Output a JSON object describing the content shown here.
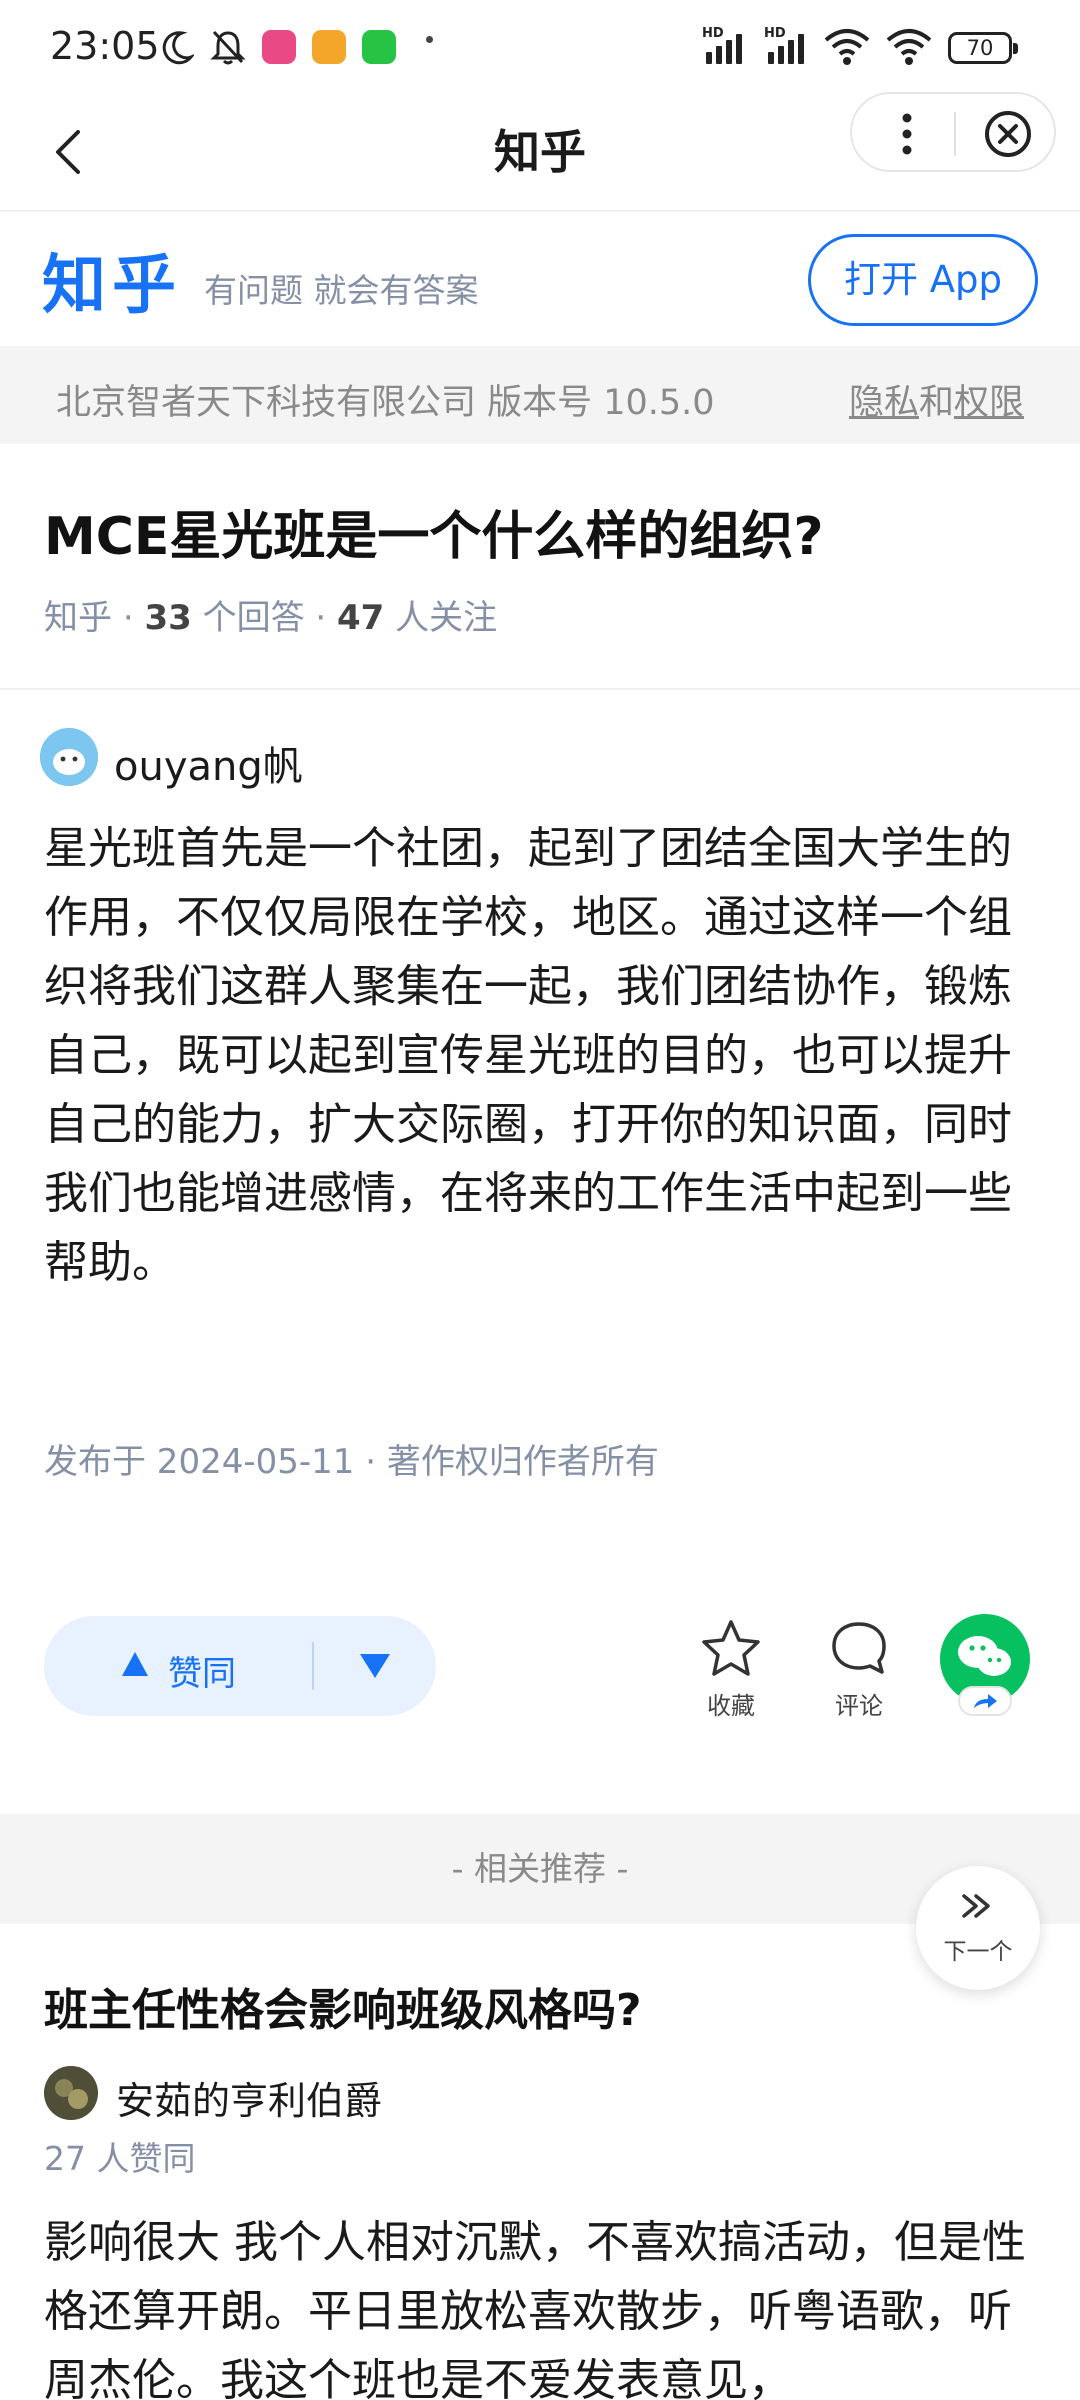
{
  "status_bar": {
    "time": "23:05",
    "battery": "70",
    "hd1": "HD",
    "hd2": "HD"
  },
  "nav": {
    "title": "知乎"
  },
  "brand": {
    "logo": "知乎",
    "slogan": "有问题 就会有答案",
    "open_app_label": "打开 App"
  },
  "company": {
    "text": "北京智者天下科技有限公司 版本号 10.5.0",
    "privacy_a": "隐私",
    "privacy_and": "和",
    "privacy_b": "权限"
  },
  "question": {
    "title": "MCE星光班是一个什么样的组织?",
    "source": "知乎",
    "answer_count": "33",
    "answer_unit": "个回答",
    "follower_count": "47",
    "follower_unit": "人关注"
  },
  "answer": {
    "author": "ouyang帆",
    "body": "星光班首先是一个社团，起到了团结全国大学生的作用，不仅仅局限在学校，地区。通过这样一个组织将我们这群人聚集在一起，我们团结协作，锻炼自己，既可以起到宣传星光班的目的，也可以提升自己的能力，扩大交际圈，打开你的知识面，同时我们也能增进感情，在将来的工作生活中起到一些帮助。",
    "published": "发布于 2024-05-11",
    "copyright": "著作权归作者所有"
  },
  "actions": {
    "upvote_label": "赞同",
    "favorite_label": "收藏",
    "comment_label": "评论"
  },
  "related": {
    "header": "- 相关推荐 -",
    "next_label": "下一个",
    "title": "班主任性格会影响班级风格吗?",
    "author": "安茹的亨利伯爵",
    "votes": "27 人赞同",
    "body": "影响很大 我个人相对沉默，不喜欢搞活动，但是性格还算开朗。平日里放松喜欢散步，听粤语歌，听周杰伦。我这个班也是不爱发表意见，"
  },
  "colors": {
    "accent": "#1772f6",
    "wechat": "#07c160",
    "meta": "#8590a6"
  }
}
